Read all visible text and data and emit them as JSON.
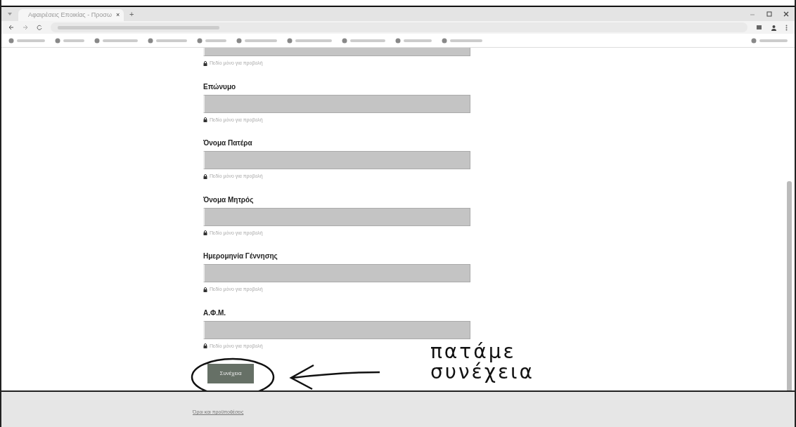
{
  "browser": {
    "tab_title": "Αφαιρέσεις Εποικίας - Προσω",
    "tab_close": "×",
    "new_tab": "+"
  },
  "form": {
    "fields": [
      {
        "hint": "Πεδίο μόνο για προβολή",
        "readonly": true
      },
      {
        "label": "Επώνυμο",
        "hint": "Πεδίο μόνο για προβολή",
        "readonly": true
      },
      {
        "label": "Όνομα Πατέρα",
        "hint": "Πεδίο μόνο για προβολή",
        "readonly": true
      },
      {
        "label": "Όνομα Μητρός",
        "hint": "Πεδίο μόνο για προβολή",
        "readonly": true
      },
      {
        "label": "Ημερομηνία Γέννησης",
        "hint": "Πεδίο μόνο για προβολή",
        "readonly": true
      },
      {
        "label": "Α.Φ.Μ.",
        "hint": "Πεδίο μόνο για προβολή",
        "readonly": true
      }
    ],
    "continue_button": "Συνέχεια"
  },
  "annotation": {
    "lines": [
      "πατάμε",
      "συνέχεια"
    ]
  },
  "footer": {
    "link": "Όροι και προϋποθέσεις"
  }
}
